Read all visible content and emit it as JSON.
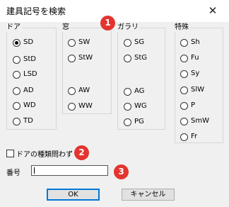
{
  "window": {
    "title": "建具記号を検索",
    "close_icon": "close-icon"
  },
  "groups": [
    {
      "title": "ドア",
      "options": [
        "SD",
        "StD",
        "LSD",
        "AD",
        "WD",
        "TD"
      ]
    },
    {
      "title": "窓",
      "options": [
        "SW",
        "StW",
        "AW",
        "WW"
      ]
    },
    {
      "title": "ガラリ",
      "options": [
        "SG",
        "StG",
        "AG",
        "WG",
        "PG"
      ]
    },
    {
      "title": "特殊",
      "options": [
        "Sh",
        "Fu",
        "Sy",
        "SlW",
        "P",
        "SmW",
        "Fr"
      ]
    }
  ],
  "selected_option": "SD",
  "badges": [
    "1",
    "2",
    "3"
  ],
  "checkbox": {
    "label": "ドアの種類問わず",
    "checked": false
  },
  "number_field": {
    "label": "番号",
    "value": ""
  },
  "buttons": {
    "ok": "OK",
    "cancel": "キャンセル"
  },
  "colors": {
    "badge": "#e3342f",
    "accent": "#0078d7"
  }
}
